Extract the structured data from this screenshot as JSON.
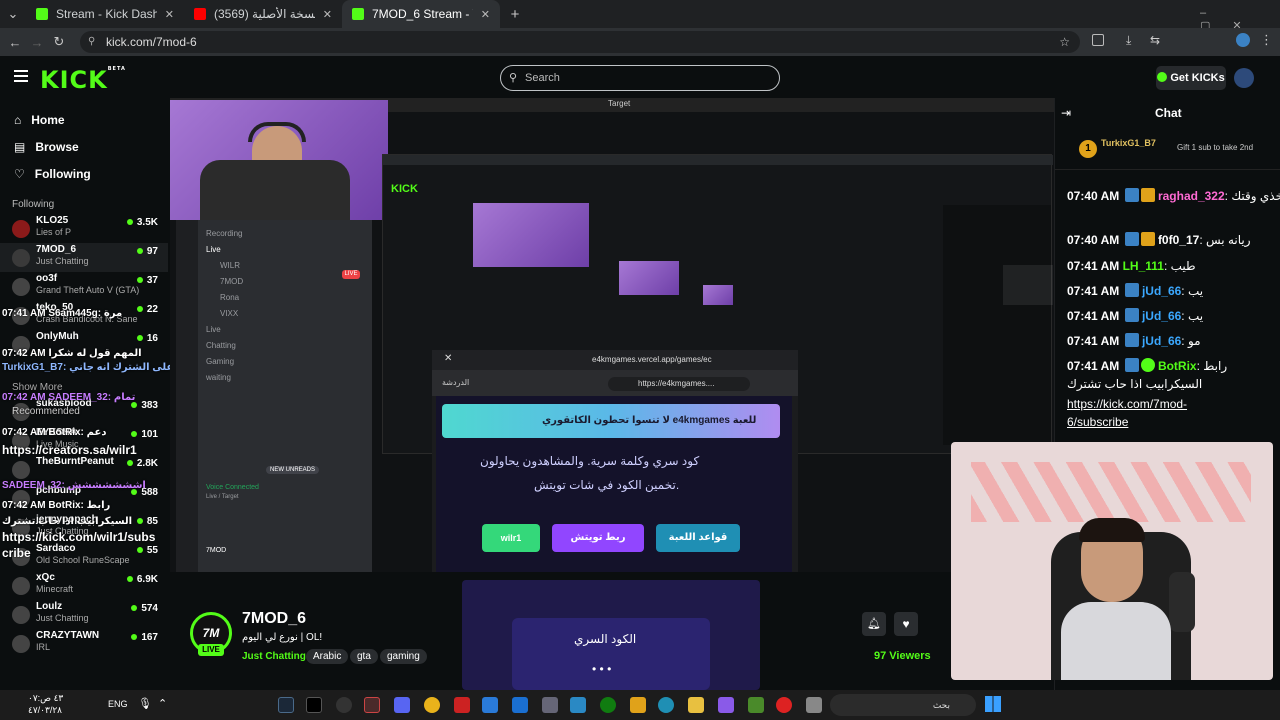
{
  "browser": {
    "tabs": [
      {
        "title": "Stream - Kick Dashboard",
        "color": "#53fc18",
        "active": false
      },
      {
        "title": "(3569) كنت ميتا (( النسخة الأصلية",
        "color": "#ff0000",
        "active": false
      },
      {
        "title": "7MOD_6 Stream - Watch Live on Kick",
        "color": "#53fc18",
        "active": true
      }
    ],
    "new_tab": "+",
    "url": "kick.com/7mod-6"
  },
  "header": {
    "logo": "KICK",
    "logo_sup": "BETA",
    "search_placeholder": "Search",
    "get_kicks": "Get KICKs"
  },
  "sidebar": {
    "nav": [
      {
        "label": "Home",
        "icon": "home-icon"
      },
      {
        "label": "Browse",
        "icon": "browse-icon"
      },
      {
        "label": "Following",
        "icon": "heart-icon"
      }
    ],
    "following_title": "Following",
    "channels": [
      {
        "name": "KLO25",
        "category": "Lies of P",
        "viewers": "3.5K"
      },
      {
        "name": "7MOD_6",
        "category": "Just Chatting",
        "viewers": "97"
      },
      {
        "name": "oo3f",
        "category": "Grand Theft Auto V (GTA)",
        "viewers": "37"
      },
      {
        "name": "teko_50",
        "category": "Crash Bandicoot N. Sane",
        "viewers": "22"
      },
      {
        "name": "OnlyMuh",
        "category": "",
        "viewers": "16"
      },
      {
        "name": "",
        "category": "",
        "viewers": ""
      },
      {
        "name": "Show More",
        "category": "",
        "viewers": ""
      },
      {
        "name": "Recommended",
        "category": "",
        "viewers": ""
      },
      {
        "name": "sukasblood",
        "category": "",
        "viewers": "383"
      },
      {
        "name": "EYESHA",
        "category": "Live Music",
        "viewers": "101"
      },
      {
        "name": "TheBurntPeanut",
        "category": "",
        "viewers": "2.8K"
      },
      {
        "name": "pchbump",
        "category": "",
        "viewers": "588"
      },
      {
        "name": "jennypopach",
        "category": "Just Chatting",
        "viewers": "85"
      },
      {
        "name": "Sardaco",
        "category": "Old School RuneScape",
        "viewers": "55"
      },
      {
        "name": "xQc",
        "category": "Minecraft",
        "viewers": "6.9K"
      },
      {
        "name": "Loulz",
        "category": "Just Chatting",
        "viewers": "574"
      },
      {
        "name": "CRAZYTAWN",
        "category": "IRL",
        "viewers": "167"
      }
    ],
    "overlay_lines": [
      "07:41 AM S6am445g: مرة",
      "07:42 AM المهم قول له شكرا",
      "TurkixG1_B7: على الشترك انه جاني",
      "07:42 AM SADEEM_32: تمام",
      "07:42 AM BotRix: دعم",
      "https://creators.sa/wilr1",
      "SADEEM_32: اششششششش",
      "07:42 AM BotRix: رابط",
      "السيكرابيب اذا حاب تشترك",
      "https://kick.com/wilr1/subs",
      "cribe"
    ]
  },
  "stream": {
    "window_title": "Target",
    "discord": {
      "channels": [
        "Recording",
        "Live",
        "Live",
        "Chatting",
        "Gaming",
        "waiting"
      ],
      "members": [
        "WILR",
        "7MOD",
        "Rona",
        "VIXX"
      ],
      "voice_status": "Voice Connected",
      "voice_sub": "Live / Target",
      "new_unreads": "NEW UNREADS",
      "user": "7MOD"
    },
    "popup": {
      "tab_title": "e4kmgames.vercel.app/games/ec",
      "url": "https://e4kmgames....",
      "sidebar_label": "الدردشة",
      "banner": "لا تنسوا تحطون الكاتقوري e4kmgames للعبة",
      "desc_line1": "كود سري وكلمة سرية. والمشاهدون يحاولون",
      "desc_line2": "تخمين الكود في شات تويتش.",
      "btn_wilr": "wilr1",
      "btn_twitch": "ربط تويتش",
      "btn_rules": "قواعد اللعبة",
      "secret_code_title": "الكود السري",
      "dots": "• • •"
    }
  },
  "channel_info": {
    "name": "7MOD_6",
    "title": "نورع لي اليوم | OL!",
    "category": "Just Chatting",
    "tags": [
      "Arabic",
      "gta",
      "gaming"
    ],
    "live": "LIVE",
    "viewers": "97 Viewers",
    "avatar_text": "7M"
  },
  "chat": {
    "title": "Chat",
    "pinned_user": "TurkixG1_B7",
    "pinned_rank": "1",
    "pinned_info": "Gift 1 sub to take 2nd",
    "messages": [
      {
        "time": "07:40 AM",
        "user": "raghad_322",
        "color": "#ff6bd4",
        "text": "خذي وقتك"
      },
      {
        "time": "07:40 AM",
        "user": "f0f0_17",
        "color": "#ffffff",
        "text": "ريانه بس"
      },
      {
        "time": "07:41 AM",
        "user": "LH_111",
        "color": "#53fc18",
        "text": "طيب"
      },
      {
        "time": "07:41 AM",
        "user": "jUd_66",
        "color": "#3ba8ff",
        "text": "يب"
      },
      {
        "time": "07:41 AM",
        "user": "jUd_66",
        "color": "#3ba8ff",
        "text": "يب"
      },
      {
        "time": "07:41 AM",
        "user": "jUd_66",
        "color": "#3ba8ff",
        "text": "مو"
      },
      {
        "time": "07:41 AM",
        "user": "BotRix",
        "color": "#53fc18",
        "text": "رابط"
      }
    ],
    "botrix_line2": "السيكرابيب اذا حاب تشترك",
    "link1": "https://kick.com/7mod-",
    "link2": "6/subscribe"
  },
  "taskbar": {
    "time": "۰۷:٤٣ ص",
    "date": "٤٧/٠٣/٢٨",
    "lang": "ENG",
    "search": "بحث"
  },
  "colors": {
    "kick_green": "#53fc18",
    "bg": "#0b0e0f",
    "popup_purple": "#2b1f5e",
    "btn_twitch": "#9146ff",
    "btn_rules": "#1f8fb4"
  }
}
